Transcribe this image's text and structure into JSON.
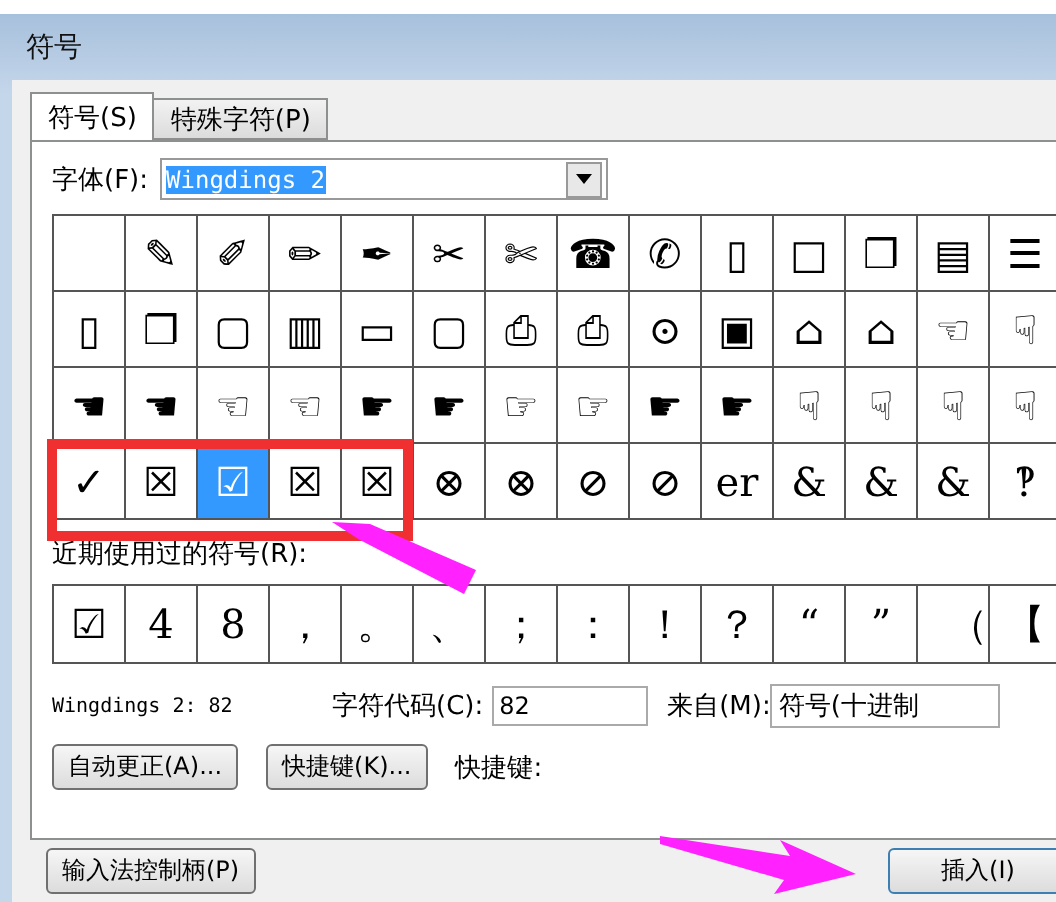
{
  "window": {
    "title": "符号"
  },
  "tabs": [
    {
      "label": "符号(S)",
      "selected": true
    },
    {
      "label": "特殊字符(P)",
      "selected": false
    }
  ],
  "font": {
    "label": "字体(F):",
    "value": "Wingdings 2"
  },
  "symbols": [
    [
      {
        "selected": false
      },
      {
        "char": "✎",
        "selected": false
      },
      {
        "char": "✐",
        "selected": false
      },
      {
        "char": "✏",
        "selected": false
      },
      {
        "char": "✒",
        "selected": false
      },
      {
        "char": "✂",
        "selected": false
      },
      {
        "char": "✄",
        "selected": false
      },
      {
        "char": "☎",
        "selected": false
      },
      {
        "char": "✆",
        "selected": false
      },
      {
        "char": "▯",
        "selected": false
      },
      {
        "char": "□",
        "selected": false
      },
      {
        "char": "❐",
        "selected": false
      },
      {
        "char": "▤",
        "selected": false
      },
      {
        "char": "☰",
        "selected": false
      }
    ],
    [
      {
        "char": "▯",
        "selected": false
      },
      {
        "char": "❐",
        "selected": false
      },
      {
        "char": "▢",
        "selected": false
      },
      {
        "char": "▥",
        "selected": false
      },
      {
        "char": "▭",
        "selected": false
      },
      {
        "char": "▢",
        "selected": false
      },
      {
        "char": "⎙",
        "selected": false
      },
      {
        "char": "⎙",
        "selected": false
      },
      {
        "char": "⊙",
        "selected": false
      },
      {
        "char": "▣",
        "selected": false
      },
      {
        "char": "⌂",
        "selected": false
      },
      {
        "char": "⌂",
        "selected": false
      },
      {
        "char": "☜",
        "selected": false
      },
      {
        "char": "☟",
        "selected": false
      }
    ],
    [
      {
        "char": "☚",
        "selected": false
      },
      {
        "char": "☚",
        "selected": false
      },
      {
        "char": "☜",
        "selected": false
      },
      {
        "char": "☜",
        "selected": false
      },
      {
        "char": "☛",
        "selected": false
      },
      {
        "char": "☛",
        "selected": false
      },
      {
        "char": "☞",
        "selected": false
      },
      {
        "char": "☞",
        "selected": false
      },
      {
        "char": "☛",
        "selected": false
      },
      {
        "char": "☛",
        "selected": false
      },
      {
        "char": "☟",
        "selected": false
      },
      {
        "char": "☟",
        "selected": false
      },
      {
        "char": "☟",
        "selected": false
      },
      {
        "char": "☟",
        "selected": false
      }
    ],
    [
      {
        "char": "✓",
        "selected": false
      },
      {
        "char": "☒",
        "selected": false
      },
      {
        "char": "☑",
        "selected": true
      },
      {
        "char": "☒",
        "selected": false
      },
      {
        "char": "☒",
        "selected": false
      },
      {
        "char": "⊗",
        "selected": false
      },
      {
        "char": "⊗",
        "selected": false
      },
      {
        "char": "⊘",
        "selected": false
      },
      {
        "char": "⊘",
        "selected": false
      },
      {
        "char": "er",
        "selected": false
      },
      {
        "char": "&",
        "selected": false
      },
      {
        "char": "&",
        "selected": false
      },
      {
        "char": "&",
        "selected": false
      },
      {
        "char": "‽",
        "selected": false
      }
    ]
  ],
  "recent": {
    "label": "近期使用过的符号(R):",
    "symbols": [
      "☑",
      "4",
      "8",
      "，",
      "。",
      "、",
      "；",
      "：",
      "！",
      "？",
      "“",
      "”",
      "（",
      "【"
    ]
  },
  "info": {
    "font_code": "Wingdings 2: 82",
    "code_label": "字符代码(C):",
    "code_value": "82",
    "from_label": "来自(M):",
    "from_value": "符号(十进制"
  },
  "buttons": [
    {
      "label": "自动更正(A)..."
    },
    {
      "label": "快捷键(K)..."
    }
  ],
  "shortcut_label": "快捷键:",
  "footer": {
    "ime_button": "输入法控制柄(P)",
    "insert_button": "插入(I)"
  }
}
